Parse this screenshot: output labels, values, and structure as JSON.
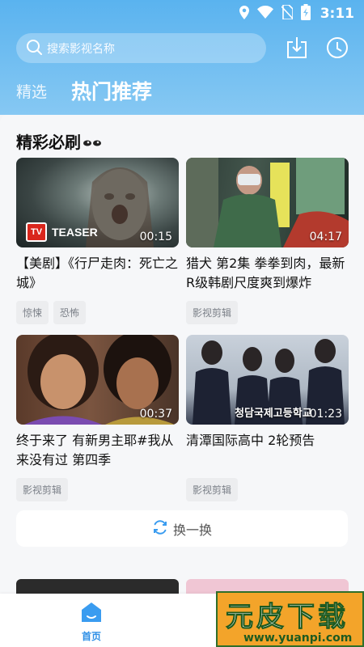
{
  "status_bar": {
    "time": "3:11",
    "icons": [
      "location-icon",
      "wifi-icon",
      "no-sim-icon",
      "battery-icon"
    ]
  },
  "search": {
    "placeholder": "搜索影视名称"
  },
  "header_icons": [
    "download-icon",
    "history-clock-icon"
  ],
  "tabs": [
    {
      "label": "精选",
      "active": false
    },
    {
      "label": "热门推荐",
      "active": true
    }
  ],
  "section": {
    "title": "精彩必刷"
  },
  "videos": [
    {
      "title": "【美剧】《行尸走肉：死亡之城》",
      "duration": "00:15",
      "badge": "TEASER",
      "tags": [
        "惊悚",
        "恐怖"
      ]
    },
    {
      "title": "猎犬 第2集 拳拳到肉，最新R级韩剧尺度爽到爆炸",
      "duration": "04:17",
      "tags": [
        "影视剪辑"
      ]
    },
    {
      "title": "终于来了 有新男主耶#我从来没有过 第四季",
      "duration": "00:37",
      "tags": [
        "影视剪辑"
      ]
    },
    {
      "title": "清潭国际高中 2轮预告",
      "duration": "01:23",
      "overlay_text": "청담국제고등학교",
      "tags": [
        "影视剪辑"
      ]
    }
  ],
  "refresh_button": {
    "label": "换一换"
  },
  "bottom_nav": {
    "home_label": "首页"
  },
  "watermark": {
    "main": "元皮下载",
    "url": "www.yuanpi.com"
  },
  "colors": {
    "accent": "#2e8fe6",
    "header_top": "#5ab3ef",
    "header_bottom": "#86c8f3"
  }
}
